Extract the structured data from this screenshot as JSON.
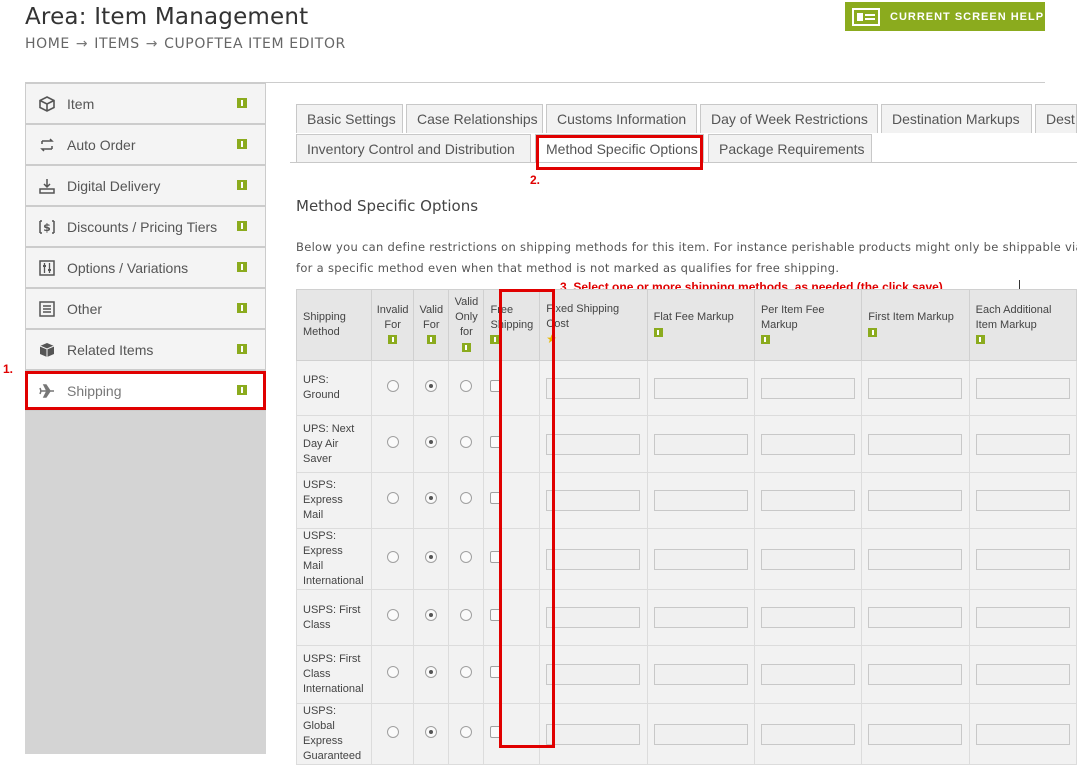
{
  "header": {
    "title": "Area: Item Management",
    "breadcrumbs": [
      "HOME",
      "ITEMS",
      "CUPOFTEA ITEM EDITOR"
    ],
    "breadcrumb_separator": "→",
    "help_button": "CURRENT SCREEN HELP"
  },
  "sidebar": {
    "items": [
      {
        "label": "Item",
        "icon": "cube-icon"
      },
      {
        "label": "Auto Order",
        "icon": "auto-order-icon"
      },
      {
        "label": "Digital Delivery",
        "icon": "download-icon"
      },
      {
        "label": "Discounts / Pricing Tiers",
        "icon": "dollar-icon"
      },
      {
        "label": "Options / Variations",
        "icon": "sliders-icon"
      },
      {
        "label": "Other",
        "icon": "list-icon"
      },
      {
        "label": "Related Items",
        "icon": "box-icon"
      },
      {
        "label": "Shipping",
        "icon": "airplane-icon"
      }
    ]
  },
  "tabs": {
    "row1": [
      "Basic Settings",
      "Case Relationships",
      "Customs Information",
      "Day of Week Restrictions",
      "Destination Markups",
      "Dest"
    ],
    "row2": [
      "Inventory Control and Distribution",
      "Method Specific Options",
      "Package Requirements"
    ],
    "active": "Method Specific Options"
  },
  "annotations": {
    "step1": "1.",
    "step2": "2.",
    "step3": "3. Select one or more shipping methods, as needed (the click save)"
  },
  "section": {
    "title": "Method Specific Options",
    "desc_line1": "Below you can define restrictions on shipping methods for this item. For instance perishable products might only be shippable via air r",
    "desc_line2": "for a specific method even when that method is not marked as qualifies for free shipping."
  },
  "table": {
    "headers": {
      "method": "Shipping Method",
      "invalid": "Invalid For",
      "valid": "Valid For",
      "valid_only": "Valid Only for",
      "free": "Free Shipping",
      "fixed": "Fixed Shipping Cost",
      "flat": "Flat Fee Markup",
      "per_item": "Per Item Fee Markup",
      "first_item": "First Item Markup",
      "each_add": "Each Additional Item Markup"
    },
    "rows": [
      {
        "method": "UPS: Ground",
        "selected": "valid",
        "free_shipping": false
      },
      {
        "method": "UPS: Next Day Air Saver",
        "selected": "valid",
        "free_shipping": false
      },
      {
        "method": "USPS: Express Mail",
        "selected": "valid",
        "free_shipping": false
      },
      {
        "method": "USPS: Express Mail International",
        "selected": "valid",
        "free_shipping": false
      },
      {
        "method": "USPS: First Class",
        "selected": "valid",
        "free_shipping": false
      },
      {
        "method": "USPS: First Class International",
        "selected": "valid",
        "free_shipping": false
      },
      {
        "method": "USPS: Global Express Guaranteed",
        "selected": "valid",
        "free_shipping": false
      }
    ]
  },
  "colors": {
    "accent": "#8bab1e",
    "annotation_red": "#e00000"
  }
}
